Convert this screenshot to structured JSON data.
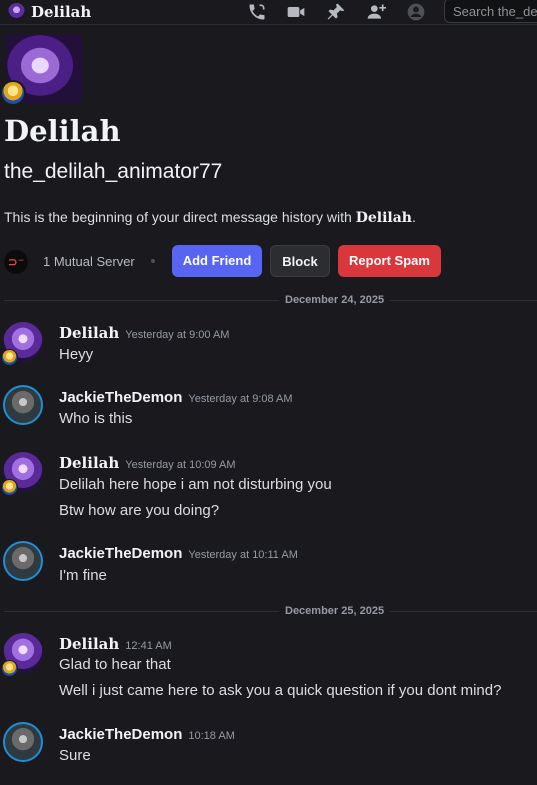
{
  "topbar": {
    "name": "Delilah",
    "search_placeholder": "Search the_de",
    "icons": [
      "voice-call-icon",
      "video-call-icon",
      "pin-icon",
      "add-friends-to-dm-icon",
      "user-profile-icon"
    ]
  },
  "header": {
    "display_name": "Delilah",
    "username": "the_delilah_animator77",
    "intro_prefix": "This is the beginning of your direct message history with ",
    "intro_name": "Delilah",
    "intro_suffix": ".",
    "mutual_servers": "1 Mutual Server",
    "add_friend": "Add Friend",
    "block": "Block",
    "report_spam": "Report Spam"
  },
  "dividers": [
    "December 24, 2025",
    "December 25, 2025"
  ],
  "messages": [
    {
      "author": "Delilah",
      "time": "Yesterday at 9:00 AM",
      "lines": [
        "Heyy"
      ]
    },
    {
      "author": "JackieTheDemon",
      "time": "Yesterday at 9:08 AM",
      "lines": [
        "Who is this"
      ]
    },
    {
      "author": "Delilah",
      "time": "Yesterday at 10:09 AM",
      "lines": [
        "Delilah here hope i am not disturbing you",
        "Btw how are you doing?"
      ]
    },
    {
      "author": "JackieTheDemon",
      "time": "Yesterday at 10:11 AM",
      "lines": [
        "I'm fine"
      ]
    },
    {
      "author": "Delilah",
      "time": "12:41 AM",
      "lines": [
        "Glad to hear that",
        "Well i just came here to ask you a quick question if you dont mind?"
      ]
    },
    {
      "author": "JackieTheDemon",
      "time": "10:18 AM",
      "lines": [
        "Sure"
      ]
    }
  ],
  "colors": {
    "background": "#1a1a1e",
    "blurple": "#5865f2",
    "danger": "#da373c",
    "muted": "#949ba4"
  }
}
